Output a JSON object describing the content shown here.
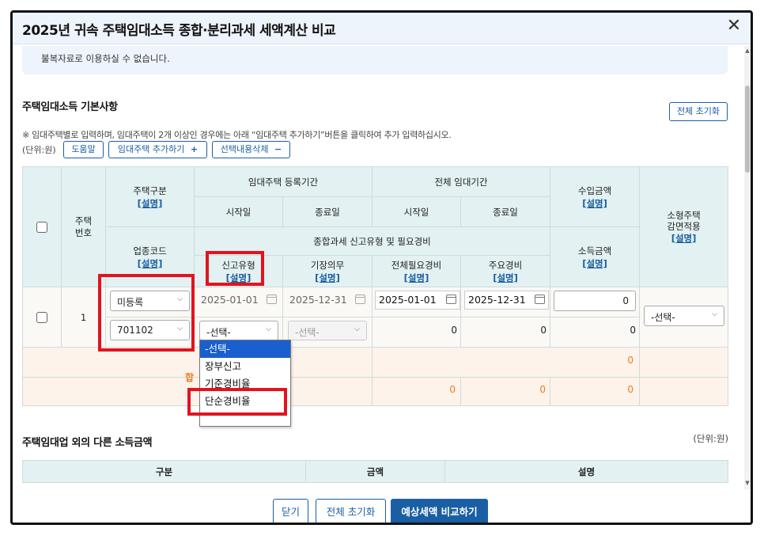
{
  "dialog": {
    "title": "2025년 귀속 주택임대소득 종합·분리과세 세액계산 비교",
    "notice": "불복자료로 이용하실 수 없습니다."
  },
  "basic": {
    "title": "주택임대소득 기본사항",
    "reset_all": "전체 초기화",
    "description": "※ 임대주택별로 입력하며, 임대주택이 2개 이상인 경우에는 아래 “임대주택 추가하기”버튼을 클릭하여 추가 입력하십시오.",
    "unit": "(단위:원)",
    "help_button": "도움말",
    "add_house_button": "임대주택 추가하기",
    "add_symbol": "+",
    "delete_button": "선택내용삭제",
    "delete_symbol": "−"
  },
  "table": {
    "house_no": "주택\n번호",
    "house_type": "주택구분",
    "explain": "[설명]",
    "reg_period": "임대주택 등록기간",
    "total_period": "전체 임대기간",
    "start": "시작일",
    "end": "종료일",
    "income_amount": "수입금액",
    "small_house": "소형주택\n감면적용",
    "industry_code": "업종코드",
    "filing_header": "종합과세 신고유형 및 필요경비",
    "filing_type": "신고유형",
    "bookkeeping": "기장의무",
    "total_expense": "전체필요경비",
    "main_expense": "주요경비",
    "earning_amount": "소득금액"
  },
  "row": {
    "number": "1",
    "house_type_value": "미등록",
    "industry_code_value": "701102",
    "reg_start": "2025-01-01",
    "reg_end": "2025-12-31",
    "total_start": "2025-01-01",
    "total_end": "2025-12-31",
    "income": "0",
    "filing_type_value": "-선택-",
    "bookkeeping_value": "-선택-",
    "total_expense_value": "0",
    "main_expense_value": "0",
    "earning_value": "0",
    "small_house_value": "-선택-"
  },
  "summary": {
    "label_partial": "합",
    "income_total": "0",
    "expense_total": "0",
    "main_total": "0",
    "earning_total": "0"
  },
  "dropdown": {
    "options": [
      "-선택-",
      "장부신고",
      "기준경비율",
      "단순경비율"
    ],
    "selected_index": 0
  },
  "other": {
    "title": "주택임대업 외의 다른 소득금액",
    "unit": "(단위:원)",
    "col_category": "구분",
    "col_amount": "금액",
    "col_explain": "설명"
  },
  "footer": {
    "close_button": "닫기",
    "reset_button": "전체 초기화",
    "compare_button": "예상세액 비교하기"
  },
  "colors": {
    "accent": "#1a5fa3",
    "header_bg": "#e3f1f2",
    "highlight_red": "#e2131d",
    "orange_text": "#f07b1f"
  }
}
